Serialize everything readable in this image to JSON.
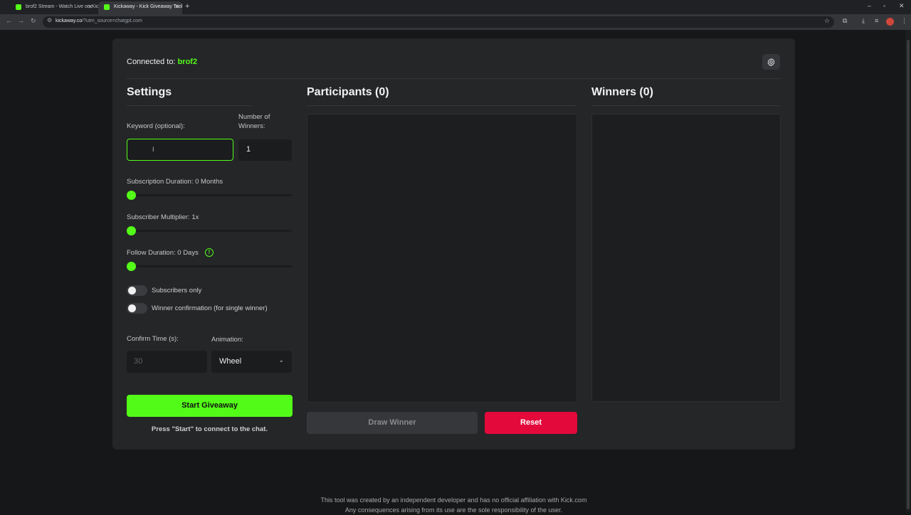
{
  "browser": {
    "tabs": [
      {
        "label": "brof2 Stream - Watch Live on Kick"
      },
      {
        "label": "Kickaway - Kick Giveaway Tool"
      }
    ],
    "new_tab": "+",
    "url_host": "kickaway.co",
    "url_path": "/?utm_source=chatgpt.com"
  },
  "app": {
    "connected_label": "Connected to: ",
    "connected_user": "brof2",
    "settings": {
      "title": "Settings",
      "keyword_label": "Keyword (optional):",
      "keyword_value": "",
      "winners_label": "Number of Winners:",
      "winners_value": "1",
      "sub_duration_label": "Subscription Duration: 0 Months",
      "sub_duration_value": 0,
      "multiplier_label": "Subscriber Multiplier: 1x",
      "multiplier_value": 1,
      "follow_label": "Follow Duration: 0 Days",
      "follow_value": 0,
      "follow_info": "!",
      "subscribers_only_label": "Subscribers only",
      "subscribers_only_on": false,
      "winner_confirm_label": "Winner confirmation (for single winner)",
      "winner_confirm_on": false,
      "confirm_time_label": "Confirm Time (s):",
      "confirm_time_value": "30",
      "animation_label": "Animation:",
      "animation_value": "Wheel",
      "start_button": "Start Giveaway",
      "start_hint": "Press \"Start\" to connect to the chat."
    },
    "participants": {
      "title": "Participants (0)",
      "draw_button": "Draw Winner",
      "reset_button": "Reset"
    },
    "winners": {
      "title": "Winners (0)"
    }
  },
  "footer": {
    "line1": "This tool was created by an independent developer and has no official affiliation with Kick.com",
    "line2": "Any consequences arising from its use are the sole responsibility of the user."
  },
  "colors": {
    "accent": "#53fc18",
    "danger": "#e4093b",
    "card": "#242628",
    "background": "#161718"
  }
}
